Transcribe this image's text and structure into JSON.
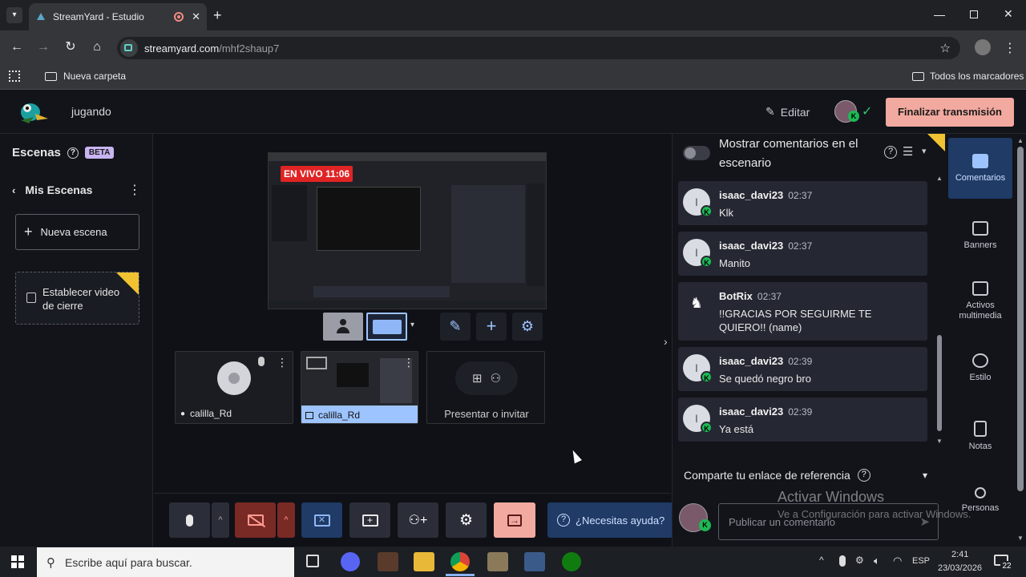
{
  "browser": {
    "tab_title": "StreamYard - Estudio",
    "url_domain": "streamyard.com",
    "url_path": "/mhf2shaup7",
    "bookmark_folder": "Nueva carpeta",
    "all_bookmarks": "Todos los marcadores"
  },
  "header": {
    "broadcast_name": "jugando",
    "edit_label": "Editar",
    "end_button": "Finalizar transmisión"
  },
  "scenes": {
    "title": "Escenas",
    "beta": "BETA",
    "my_scenes": "Mis Escenas",
    "new_scene": "Nueva escena",
    "closing_video": "Establecer video de cierre"
  },
  "preview": {
    "live_badge": "EN VIVO 11:06"
  },
  "participants": [
    {
      "name": "calilla_Rd"
    },
    {
      "name": "calilla_Rd"
    }
  ],
  "invite_label": "Presentar o invitar",
  "help_button": "¿Necesitas ayuda?",
  "comments": {
    "toggle_label": "Mostrar comentarios en el escenario",
    "items": [
      {
        "author": "isaac_davi23",
        "time": "02:37",
        "text": "Klk"
      },
      {
        "author": "isaac_davi23",
        "time": "02:37",
        "text": "Manito"
      },
      {
        "author": "BotRix",
        "time": "02:37",
        "text": "!!GRACIAS POR SEGUIRME TE QUIERO!! (name)"
      },
      {
        "author": "isaac_davi23",
        "time": "02:39",
        "text": "Se quedó negro bro"
      },
      {
        "author": "isaac_davi23",
        "time": "02:39",
        "text": "Ya está"
      }
    ],
    "share_link": "Comparte tu enlace de referencia",
    "input_placeholder": "Publicar un comentario"
  },
  "sidebar": {
    "items": [
      "Comentarios",
      "Banners",
      "Activos multimedia",
      "Estilo",
      "Notas",
      "Personas"
    ]
  },
  "watermark": {
    "line1": "Activar Windows",
    "line2": "Ve a Configuración para activar Windows."
  },
  "taskbar": {
    "search_placeholder": "Escribe aquí para buscar.",
    "lang": "ESP",
    "time": "2:41",
    "date": "23/03/2026",
    "notif_count": "22"
  },
  "colors": {
    "accent": "#f2a99f",
    "live": "#e02424",
    "badge": "#1db954",
    "primary_blue": "#4f8fe6"
  }
}
